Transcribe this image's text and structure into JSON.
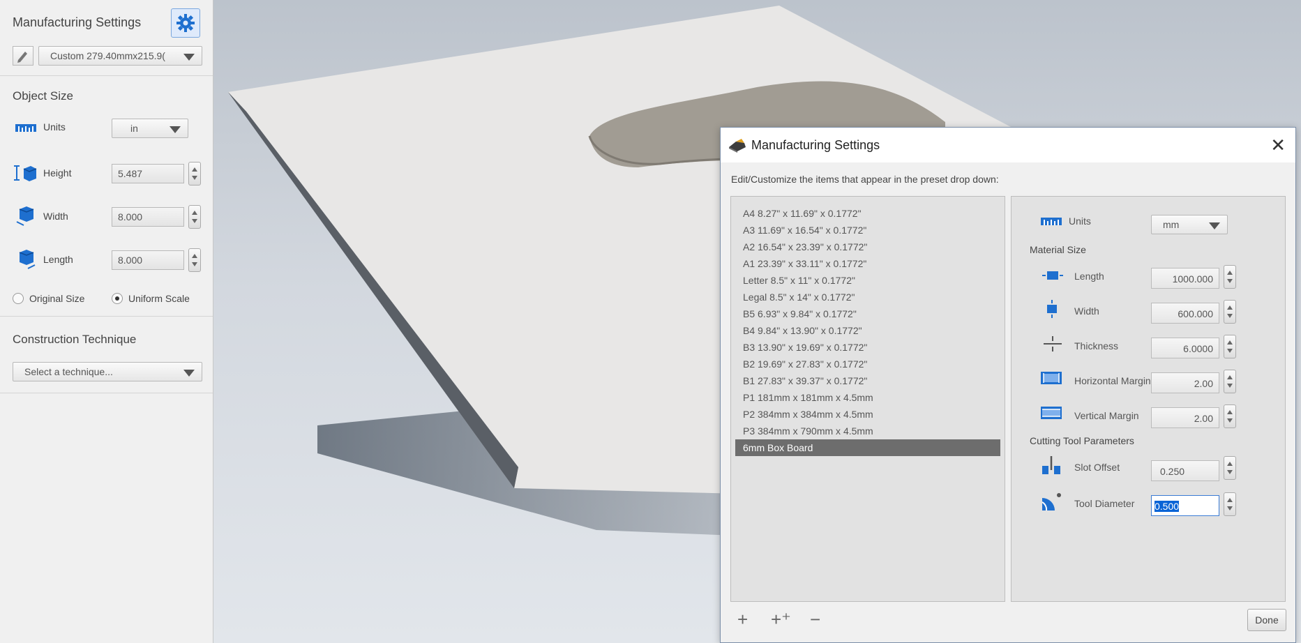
{
  "left_panel": {
    "title": "Manufacturing Settings",
    "preset_value": "Custom 279.40mmx215.9(",
    "object_size": {
      "heading": "Object Size",
      "units_label": "Units",
      "units_value": "in",
      "height_label": "Height",
      "height_value": "5.487",
      "width_label": "Width",
      "width_value": "8.000",
      "length_label": "Length",
      "length_value": "8.000",
      "original_size_label": "Original Size",
      "uniform_scale_label": "Uniform Scale"
    },
    "construction": {
      "heading": "Construction Technique",
      "select_placeholder": "Select a technique..."
    }
  },
  "dialog": {
    "title": "Manufacturing Settings",
    "close": "✕",
    "instruction": "Edit/Customize the items that appear in the preset drop down:",
    "presets": [
      "A4 8.27\" x 11.69\" x 0.1772\"",
      "A3 11.69\" x 16.54\" x 0.1772\"",
      "A2 16.54\" x 23.39\" x 0.1772\"",
      "A1 23.39\" x 33.11\" x 0.1772\"",
      "Letter 8.5\" x 11\" x 0.1772\"",
      "Legal 8.5\" x 14\" x 0.1772\"",
      "B5 6.93\" x 9.84\" x 0.1772\"",
      "B4 9.84\" x 13.90\" x 0.1772\"",
      "B3 13.90\" x 19.69\" x 0.1772\"",
      "B2 19.69\" x 27.83\" x 0.1772\"",
      "B1 27.83\" x 39.37\" x 0.1772\"",
      "P1 181mm x 181mm x 4.5mm",
      "P2 384mm x 384mm x 4.5mm",
      "P3 384mm x 790mm x 4.5mm",
      "6mm Box Board"
    ],
    "selected_preset": "6mm Box Board",
    "units_label": "Units",
    "units_value": "mm",
    "material_size_heading": "Material Size",
    "length_label": "Length",
    "length_value": "1000.000",
    "width_label": "Width",
    "width_value": "600.000",
    "thickness_label": "Thickness",
    "thickness_value": "6.0000",
    "hmargin_label": "Horizontal Margin",
    "hmargin_value": "2.00",
    "vmargin_label": "Vertical Margin",
    "vmargin_value": "2.00",
    "cutting_heading": "Cutting Tool Parameters",
    "slot_offset_label": "Slot Offset",
    "slot_offset_value": "0.250",
    "tool_diameter_label": "Tool Diameter",
    "tool_diameter_value": "0.500",
    "add_symbol": "+",
    "add_copy_symbol": "+⁺",
    "remove_symbol": "−",
    "done_label": "Done"
  },
  "colors": {
    "accent": "#3a7bd5",
    "icon_blue": "#1e6fcf",
    "selected_row": "#6d6d6d"
  }
}
